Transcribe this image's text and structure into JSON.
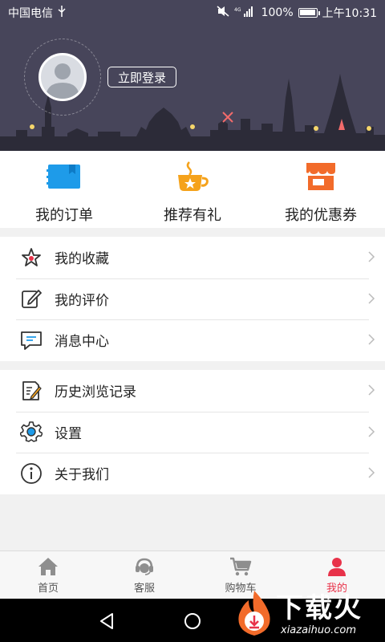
{
  "status_bar": {
    "carrier": "中国电信",
    "battery": "100%",
    "battery_level": 1.0,
    "time": "上午10:31",
    "network": "4G"
  },
  "header": {
    "login_button": "立即登录",
    "background_color": "#47455a"
  },
  "quick_actions": [
    {
      "label": "我的订单",
      "icon": "order-book-icon",
      "color": "#1e9be9"
    },
    {
      "label": "推荐有礼",
      "icon": "coffee-cup-icon",
      "color": "#f5a21b"
    },
    {
      "label": "我的优惠券",
      "icon": "shop-icon",
      "color": "#f26b2a"
    }
  ],
  "menu_group_1": [
    {
      "label": "我的收藏",
      "icon": "star-icon"
    },
    {
      "label": "我的评价",
      "icon": "edit-icon"
    },
    {
      "label": "消息中心",
      "icon": "message-icon"
    }
  ],
  "menu_group_2": [
    {
      "label": "历史浏览记录",
      "icon": "history-icon"
    },
    {
      "label": "设置",
      "icon": "gear-icon"
    },
    {
      "label": "关于我们",
      "icon": "info-icon"
    }
  ],
  "bottom_nav": [
    {
      "label": "首页",
      "icon": "home-icon",
      "active": false
    },
    {
      "label": "客服",
      "icon": "customer-service-icon",
      "active": false
    },
    {
      "label": "购物车",
      "icon": "cart-icon",
      "active": false
    },
    {
      "label": "我的",
      "icon": "user-icon",
      "active": true
    }
  ],
  "accent_color": "#e8334a",
  "watermark": {
    "title": "下载火",
    "subtitle": "xiazaihuo.com"
  }
}
